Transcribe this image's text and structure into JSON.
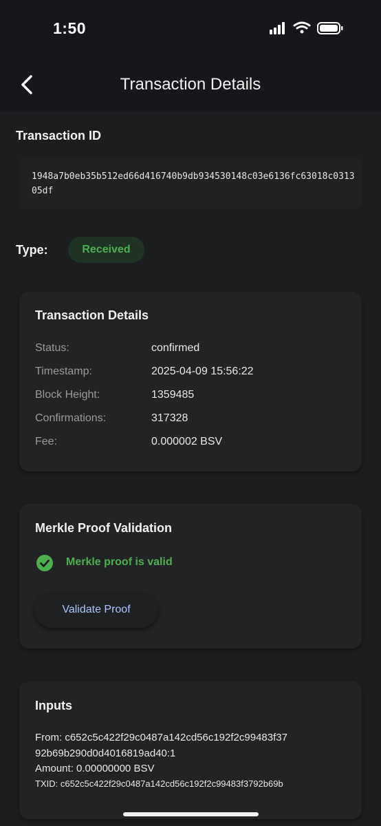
{
  "status_bar": {
    "time": "1:50"
  },
  "header": {
    "title": "Transaction Details"
  },
  "transaction_id": {
    "label": "Transaction ID",
    "value": "1948a7b0eb35b512ed66d416740b9db934530148c03e6136fc63018c031305df"
  },
  "type": {
    "label": "Type:",
    "value": "Received",
    "color": "#4caf50"
  },
  "details": {
    "title": "Transaction Details",
    "rows": [
      {
        "key": "Status:",
        "value": "confirmed"
      },
      {
        "key": "Timestamp:",
        "value": "2025-04-09 15:56:22"
      },
      {
        "key": "Block Height:",
        "value": "1359485"
      },
      {
        "key": "Confirmations:",
        "value": "317328"
      },
      {
        "key": "Fee:",
        "value": "0.000002 BSV"
      }
    ]
  },
  "merkle": {
    "title": "Merkle Proof Validation",
    "status_text": "Merkle proof is valid",
    "button_label": "Validate Proof"
  },
  "inputs": {
    "title": "Inputs",
    "from_line1": "From: c652c5c422f29c0487a142cd56c192f2c99483f37",
    "from_line2": "92b69b290d0d4016819ad40:1",
    "amount": "Amount: 0.00000000 BSV",
    "txid": "TXID: c652c5c422f29c0487a142cd56c192f2c99483f3792b69b"
  },
  "icons": {
    "back": "chevron-left-icon",
    "valid": "check-circle-icon",
    "signal": "signal-icon",
    "wifi": "wifi-icon",
    "battery": "battery-icon"
  }
}
